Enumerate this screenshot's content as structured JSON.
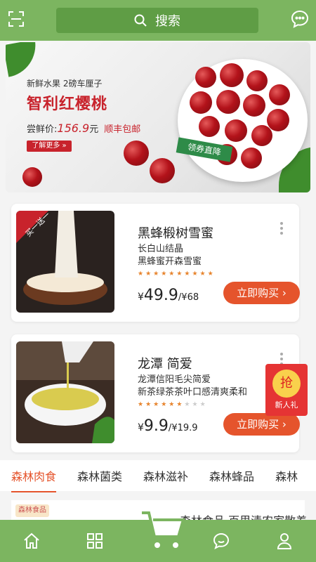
{
  "header": {
    "search_label": "搜索"
  },
  "banner": {
    "subtitle": "新鲜水果 2磅车厘子",
    "title": "智利红樱桃",
    "price_label": "尝鲜价:",
    "price_value": "156.9",
    "price_unit": "元",
    "shipping": "顺丰包邮",
    "more": "了解更多 »",
    "ribbon": "领券直降"
  },
  "products": [
    {
      "name": "黑蜂椴树雪蜜",
      "desc1": "长白山结晶",
      "desc2": "黑蜂蜜开森雪蜜",
      "currency": "¥",
      "price": "49.9",
      "sep": "/",
      "old_price": "¥68",
      "buy": "立即购买",
      "corner_tag": "买一送一",
      "rating": 10,
      "rating_max": 10
    },
    {
      "name": "龙潭 简爱",
      "desc1": "龙潭信阳毛尖简爱",
      "desc2": "新茶绿茶茶叶口感清爽柔和",
      "currency": "¥",
      "price": "9.9",
      "sep": "/",
      "old_price": "¥19.9",
      "buy": "立即购买",
      "rating": 6,
      "rating_max": 9
    }
  ],
  "badge": {
    "coin": "抢",
    "label": "新人礼"
  },
  "tabs": [
    "森林肉食",
    "森林菌类",
    "森林滋补",
    "森林蜂品",
    "森林"
  ],
  "next_item": {
    "tag": "森林食品",
    "title": "森林食品 百里清农家散养"
  },
  "nav_icons": [
    "home-icon",
    "grid-icon",
    "cart-icon",
    "message-icon",
    "user-icon"
  ],
  "colors": {
    "brand": "#7cb560",
    "accent": "#e5542c",
    "price_red": "#c8232c"
  }
}
